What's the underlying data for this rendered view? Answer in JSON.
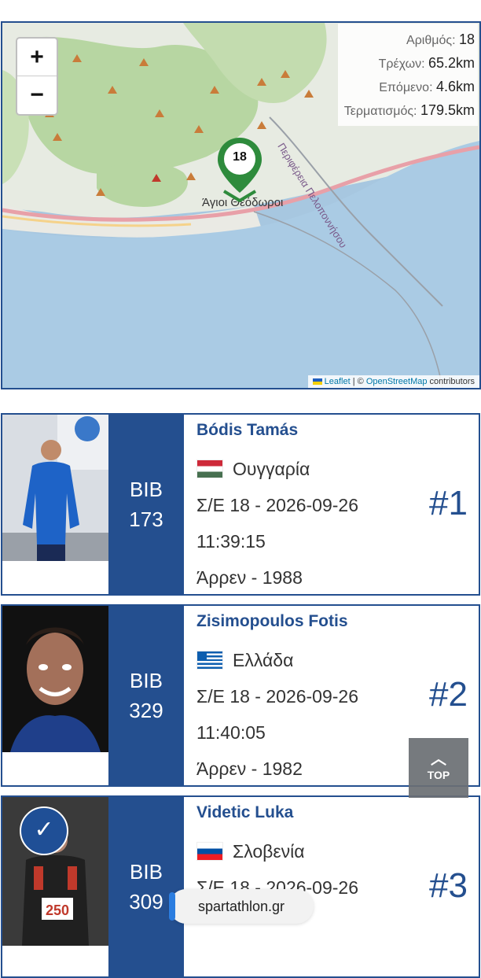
{
  "map": {
    "zoom_in": "+",
    "zoom_out": "−",
    "info": [
      {
        "label": "Αριθμός:",
        "value": "18"
      },
      {
        "label": "Τρέχων:",
        "value": "65.2km"
      },
      {
        "label": "Επόμενο:",
        "value": "4.6km"
      },
      {
        "label": "Τερματισμός:",
        "value": "179.5km"
      }
    ],
    "marker_number": "18",
    "place_label": "Άγιοι Θεόδωροι",
    "region_label": "Περιφέρεια Πελοποννήσου",
    "attribution": {
      "leaflet": "Leaflet",
      "sep": " | © ",
      "osm": "OpenStreetMap",
      "suffix": " contributors"
    }
  },
  "runners": [
    {
      "name": "Bódis Tamás",
      "bib_label": "BIB",
      "bib": "173",
      "country": "Ουγγαρία",
      "checkpoint": "Σ/Ε 18 - 2026-09-26",
      "time": "11:39:15",
      "category": "Άρρεν - 1988",
      "rank": "#1"
    },
    {
      "name": "Zisimopoulos Fotis",
      "bib_label": "BIB",
      "bib": "329",
      "country": "Ελλάδα",
      "checkpoint": "Σ/Ε 18 - 2026-09-26",
      "time": "11:40:05",
      "category": "Άρρεν - 1982",
      "rank": "#2"
    },
    {
      "name": "Videtic Luka",
      "bib_label": "BIB",
      "bib": "309",
      "country": "Σλοβενία",
      "checkpoint": "Σ/Ε 18 - 2026-09-26",
      "time": "",
      "category": "",
      "rank": "#3"
    }
  ],
  "photo3_bib": "250",
  "top_button": "TOP",
  "url": "spartathlon.gr",
  "colors": {
    "primary": "#244f8f",
    "marker": "#2e8b3c"
  }
}
